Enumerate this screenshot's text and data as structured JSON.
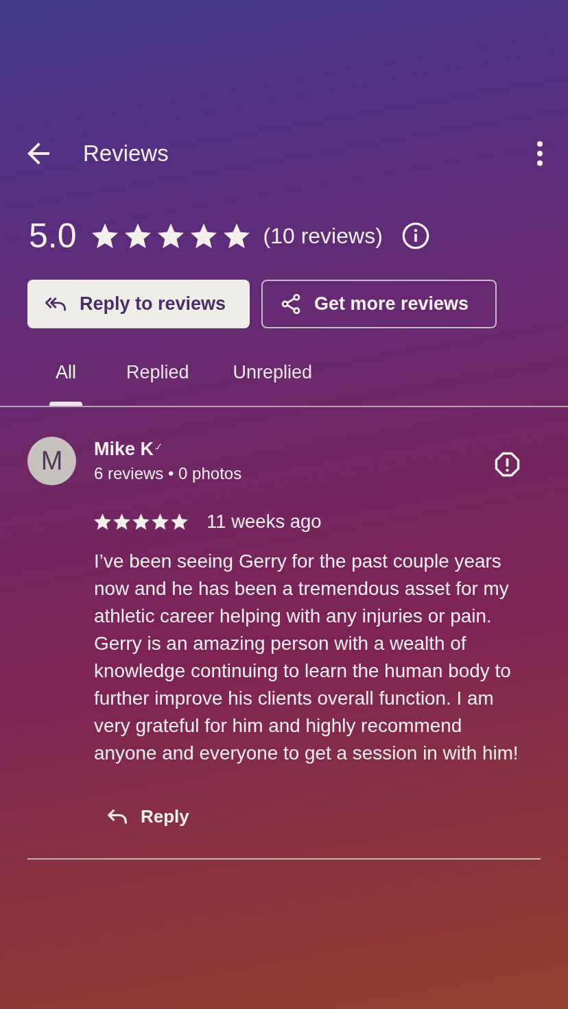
{
  "app_bar": {
    "title": "Reviews"
  },
  "summary": {
    "rating": "5.0",
    "stars": 5,
    "count": "(10 reviews)"
  },
  "actions": [
    {
      "label": "Reply to reviews",
      "kind": "filled"
    },
    {
      "label": "Get more reviews",
      "kind": "outlined"
    }
  ],
  "tabs": [
    {
      "label": "All",
      "selected": true
    },
    {
      "label": "Replied",
      "selected": false
    },
    {
      "label": "Unreplied",
      "selected": false
    }
  ],
  "reviews": [
    {
      "avatar_letter": "M",
      "author": "Mike K",
      "meta": "6 reviews • 0 photos",
      "stars": 5,
      "time": "11 weeks ago",
      "text": "I’ve been seeing Gerry for the past couple years now and he has been a tremendous asset for my athletic career helping with any injuries or pain. Gerry is an amazing person with a wealth of knowledge continuing to learn the human body to further improve his clients overall function. I am very grateful for him and highly recommend anyone and everyone to get a session in with him!",
      "reply_label": "Reply"
    }
  ]
}
